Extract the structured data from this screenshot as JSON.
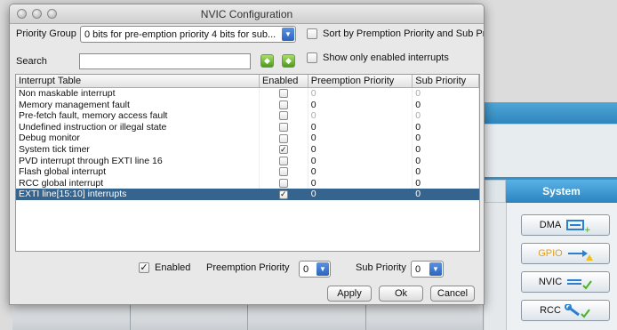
{
  "window": {
    "title": "NVIC Configuration"
  },
  "priority_group": {
    "label": "Priority Group",
    "value": "0 bits for pre-emption priority 4 bits for sub..."
  },
  "sort_option": {
    "label": "Sort by Premption Priority and Sub Priorit",
    "checked": false
  },
  "search": {
    "label": "Search",
    "value": ""
  },
  "show_enabled": {
    "label": "Show only enabled interrupts",
    "checked": false
  },
  "table": {
    "columns": [
      "Interrupt Table",
      "Enabled",
      "Preemption Priority",
      "Sub Priority"
    ],
    "rows": [
      {
        "name": "Non maskable interrupt",
        "enabled": false,
        "preemption": "0",
        "sub": "0",
        "dim": true,
        "selected": false
      },
      {
        "name": "Memory management fault",
        "enabled": false,
        "preemption": "0",
        "sub": "0",
        "dim": false,
        "selected": false
      },
      {
        "name": "Pre-fetch fault, memory access fault",
        "enabled": false,
        "preemption": "0",
        "sub": "0",
        "dim": true,
        "selected": false
      },
      {
        "name": "Undefined instruction or illegal state",
        "enabled": false,
        "preemption": "0",
        "sub": "0",
        "dim": false,
        "selected": false
      },
      {
        "name": "Debug monitor",
        "enabled": false,
        "preemption": "0",
        "sub": "0",
        "dim": false,
        "selected": false
      },
      {
        "name": "System tick timer",
        "enabled": true,
        "preemption": "0",
        "sub": "0",
        "dim": false,
        "selected": false
      },
      {
        "name": "PVD interrupt through EXTI line 16",
        "enabled": false,
        "preemption": "0",
        "sub": "0",
        "dim": false,
        "selected": false
      },
      {
        "name": "Flash global interrupt",
        "enabled": false,
        "preemption": "0",
        "sub": "0",
        "dim": false,
        "selected": false
      },
      {
        "name": "RCC global interrupt",
        "enabled": false,
        "preemption": "0",
        "sub": "0",
        "dim": false,
        "selected": false
      },
      {
        "name": "EXTI line[15:10] interrupts",
        "enabled": true,
        "preemption": "0",
        "sub": "0",
        "dim": false,
        "selected": true
      }
    ]
  },
  "bottom": {
    "enabled_label": "Enabled",
    "enabled_checked": true,
    "preemption_label": "Preemption Priority",
    "preemption_value": "0",
    "sub_label": "Sub Priority",
    "sub_value": "0"
  },
  "buttons": {
    "apply": "Apply",
    "ok": "Ok",
    "cancel": "Cancel"
  },
  "background": {
    "system_header": "System",
    "buttons": [
      "DMA",
      "GPIO",
      "NVIC",
      "RCC"
    ]
  },
  "icons": {
    "add": "add-icon",
    "remove": "remove-icon",
    "checkmark": "✓"
  },
  "colors": {
    "selection": "#35658f",
    "accent_blue": "#2f86bd",
    "green": "#4f9a1e"
  }
}
